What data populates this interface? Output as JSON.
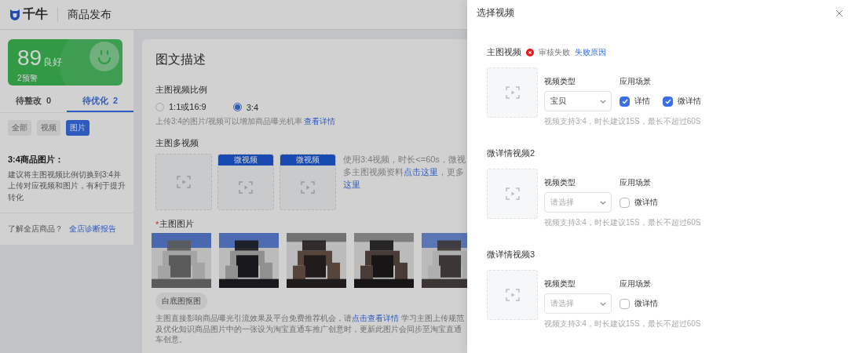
{
  "header": {
    "app_name": "千牛",
    "page_title": "商品发布"
  },
  "sidebar": {
    "score": {
      "value": "89",
      "grade": "良好",
      "warnings": "2预警"
    },
    "tabs": [
      {
        "label": "待整改",
        "count": "0",
        "selected": false
      },
      {
        "label": "待优化",
        "count": "2",
        "selected": true
      }
    ],
    "filters": [
      {
        "label": "全部",
        "selected": false
      },
      {
        "label": "视频",
        "selected": false
      },
      {
        "label": "图片",
        "selected": true
      }
    ],
    "tip": {
      "title": "3:4商品图片：",
      "text": "建议将主图视频比例切换到3:4并上传对应视频和图片，有利于提升转化"
    },
    "footer": {
      "text": "了解全店商品？",
      "link": "全店诊断报告"
    }
  },
  "main": {
    "title": "图文描述",
    "ratio": {
      "label": "主图视频比例",
      "options": [
        {
          "label": "1:1或16:9",
          "selected": false
        },
        {
          "label": "3:4",
          "selected": true
        }
      ],
      "hint": "上传3:4的图片/视频可以增加商品曝光机率",
      "hint_link": "查看详情"
    },
    "videos": {
      "label": "主图多视频",
      "slots": [
        {
          "kind": "plain"
        },
        {
          "kind": "tagged",
          "tag": "微视频"
        },
        {
          "kind": "tagged",
          "tag": "微视频"
        }
      ],
      "note": {
        "text": "使用3:4视频，时长<=60s，微视",
        "text_2": "多主图视频资料",
        "link": "点击这里",
        "text_after": "，更多",
        "link_2": "这里"
      }
    },
    "images": {
      "required_mark": "*",
      "label": "主图图片"
    },
    "cutout_button": "白底图抠图",
    "footnote": {
      "before": "主图直接影响商品曝光引流效果及平台免费推荐机会，请",
      "link": "点击查看详情",
      "after": " 学习主图上传规范及优化知识商品图片中的一张设为淘宝直通车推广创意时，更新此图片会同步至淘宝直通车创意。"
    }
  },
  "drawer": {
    "title": "选择视频",
    "sections": [
      {
        "title": "主图视频",
        "status": {
          "kind": "error",
          "text": "审核失败",
          "link": "失败原因"
        },
        "type_label": "视频类型",
        "type": {
          "value": "宝贝"
        },
        "scene_label": "应用场景",
        "scenes": [
          {
            "label": "详情",
            "checked": true
          },
          {
            "label": "微详情",
            "checked": true
          }
        ],
        "hint": "视频支持3:4，时长建议15S，最长不超过60S"
      },
      {
        "title": "微详情视频2",
        "type_label": "视频类型",
        "type": {
          "placeholder": "请选择"
        },
        "scene_label": "应用场景",
        "scenes": [
          {
            "label": "微详情",
            "checked": false
          }
        ],
        "hint": "视频支持3:4，时长建议15S，最长不超过60S"
      },
      {
        "title": "微详情视频3",
        "type_label": "视频类型",
        "type": {
          "placeholder": "请选择"
        },
        "scene_label": "应用场景",
        "scenes": [
          {
            "label": "微详情",
            "checked": false
          }
        ],
        "hint": "视频支持3:4，时长建议15S，最长不超过60S"
      }
    ]
  }
}
